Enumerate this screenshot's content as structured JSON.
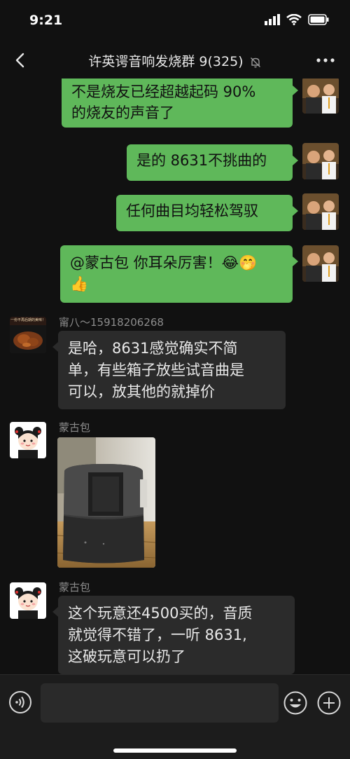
{
  "status_bar": {
    "time": "9:21",
    "icons": [
      "signal-icon",
      "wifi-icon",
      "battery-icon"
    ]
  },
  "header": {
    "title": "许英谔音响发烧群 9(325)",
    "back_icon": "back-chevron-icon",
    "mute_icon": "bell-muted-icon",
    "more_icon": "more-dots-icon"
  },
  "messages": [
    {
      "side": "right",
      "lines": [
        "不是烧友已经超越起码 90%",
        "的烧友的声音了"
      ]
    },
    {
      "side": "right",
      "lines": [
        "是的 8631不挑曲的"
      ]
    },
    {
      "side": "right",
      "lines": [
        "任何曲目均轻松驾驭"
      ]
    },
    {
      "side": "right",
      "lines": [
        "@蒙古包 你耳朵厉害！😂🤭",
        "👍"
      ]
    },
    {
      "side": "left",
      "sender": "甯八～15918206268",
      "avatar_caption": "一份不再后期的美味！",
      "lines": [
        "是哈，8631感觉确实不简",
        "单，有些箱子放些试音曲是",
        "可以，放其他的就掉价"
      ]
    },
    {
      "side": "left",
      "sender": "蒙古包",
      "image": "speaker-photo"
    },
    {
      "side": "left",
      "sender": "蒙古包",
      "lines": [
        "这个玩意还4500买的，音质",
        "就觉得不错了，一听 8631,",
        "这破玩意可以扔了"
      ]
    }
  ],
  "input_bar": {
    "value": "",
    "icons": [
      "voice-icon",
      "emoji-icon",
      "plus-icon"
    ]
  },
  "colors": {
    "background": "#111111",
    "bubble_self": "#5fb85a",
    "bubble_other": "#2b2b2b",
    "sender_name": "#8c8c8c"
  }
}
